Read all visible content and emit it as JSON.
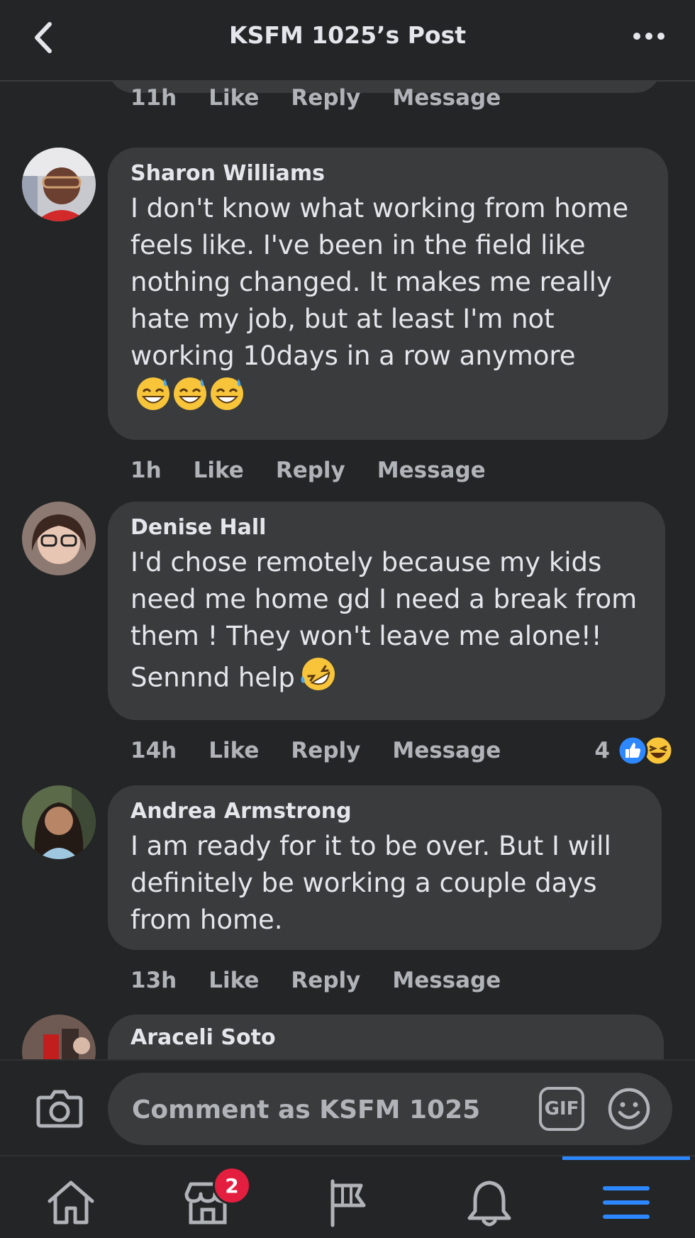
{
  "header": {
    "title": "KSFM 1025’s Post"
  },
  "top_action_row": {
    "time": "11h",
    "like": "Like",
    "reply": "Reply",
    "message": "Message"
  },
  "comments": [
    {
      "author": "Sharon Williams",
      "text": "I don't know what working from home feels like. I've been in the field like nothing changed. It makes me really hate my job, but at least I'm not working 10days in a row anymore",
      "emoji": "grinning-face-with-sweat x3",
      "time": "1h",
      "like": "Like",
      "reply": "Reply",
      "message": "Message"
    },
    {
      "author": "Denise Hall",
      "text": "I'd chose remotely because my kids need me home gd I need a break from them ! They won't leave me alone!! Sennnd help",
      "emoji": "rolling-on-the-floor-laughing",
      "time": "14h",
      "like": "Like",
      "reply": "Reply",
      "message": "Message",
      "reaction_count": "4",
      "reactions": [
        "like",
        "haha"
      ]
    },
    {
      "author": "Andrea Armstrong",
      "text": "I am ready for it to be over. But I will definitely be working a couple days from home.",
      "time": "13h",
      "like": "Like",
      "reply": "Reply",
      "message": "Message"
    },
    {
      "author": "Araceli Soto"
    }
  ],
  "composer": {
    "placeholder": "Comment as KSFM 1025",
    "gif_label": "GIF"
  },
  "nav": {
    "marketplace_badge": "2",
    "active": "menu"
  },
  "colors": {
    "background": "#242526",
    "bubble": "#3a3b3c",
    "text_primary": "#e4e6eb",
    "text_secondary": "#b0b3b8",
    "accent": "#2d88ff",
    "badge": "#e41e3f"
  }
}
